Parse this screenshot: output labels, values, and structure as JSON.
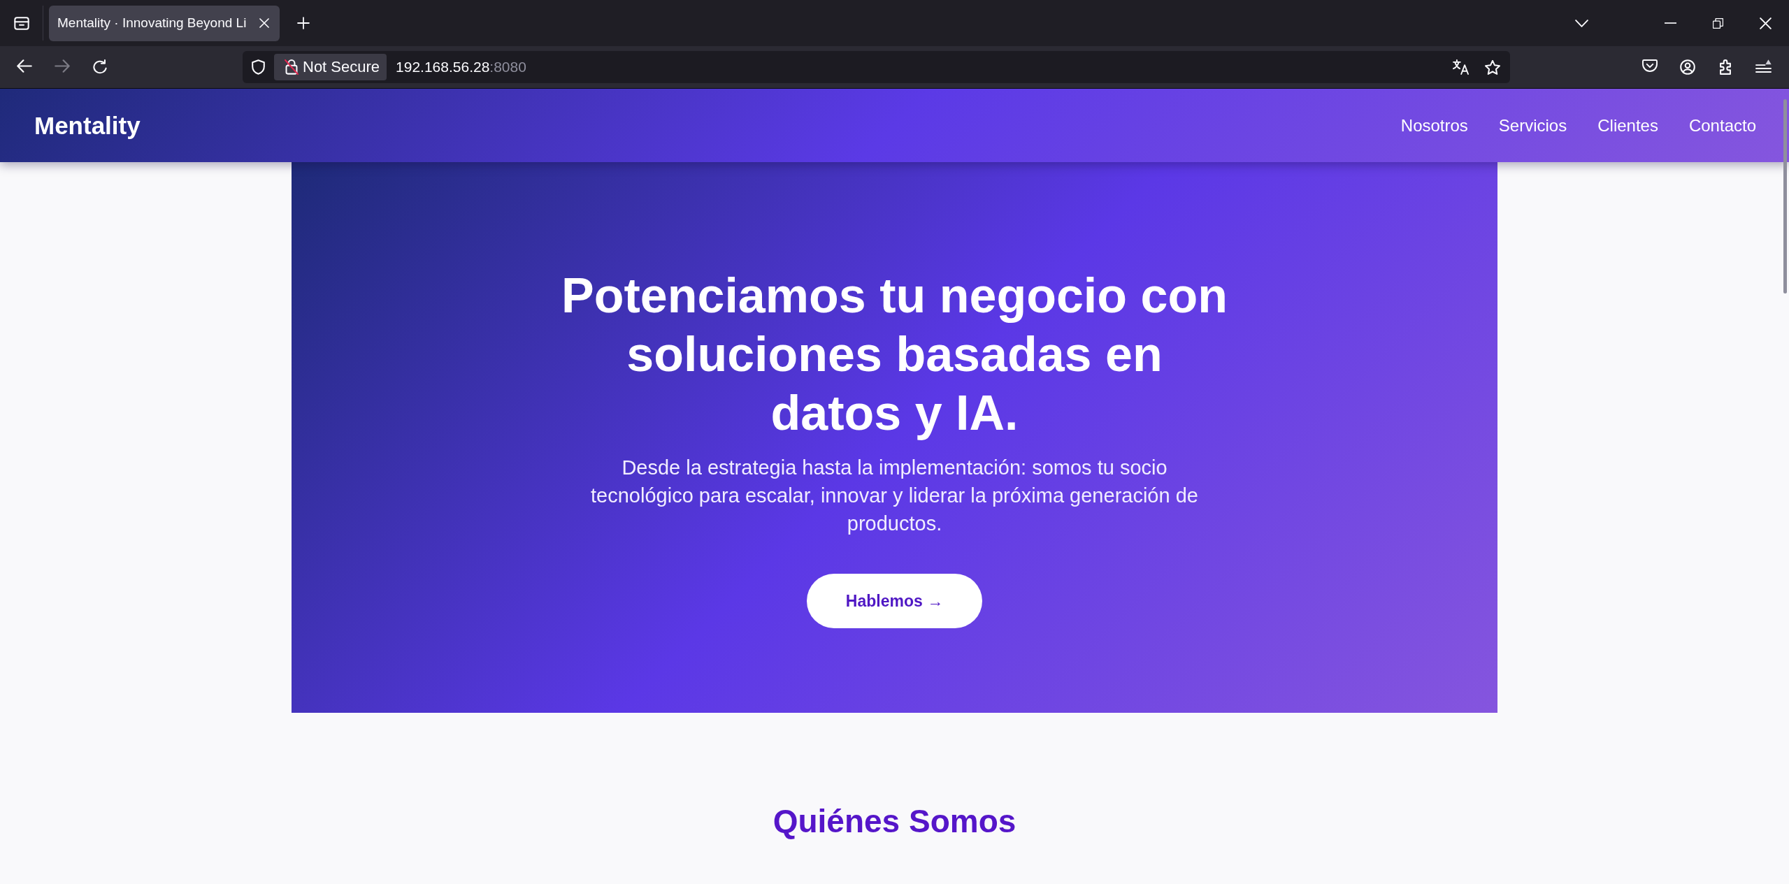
{
  "browser": {
    "tabs": [
      {
        "title": "Mentality · Innovating Beyond Li",
        "selected": true
      }
    ],
    "nav_buttons": [
      {
        "kind": "back",
        "disabled": false
      },
      {
        "kind": "forward",
        "disabled": true
      },
      {
        "kind": "reload",
        "disabled": false
      }
    ],
    "address": {
      "security_label": "Not Secure",
      "host": "192.168.56.28",
      "port": ":8080"
    }
  },
  "navbar": {
    "brand": "Mentality",
    "links": [
      "Nosotros",
      "Servicios",
      "Clientes",
      "Contacto"
    ]
  },
  "hero": {
    "title": "Potenciamos tu negocio con soluciones basadas en datos y IA.",
    "subtitle": "Desde la estrategia hasta la implementación: somos tu socio tecnológico para escalar, innovar y liderar la próxima generación de productos.",
    "cta": "Hablemos →"
  },
  "about": {
    "heading": "Quiénes Somos"
  }
}
